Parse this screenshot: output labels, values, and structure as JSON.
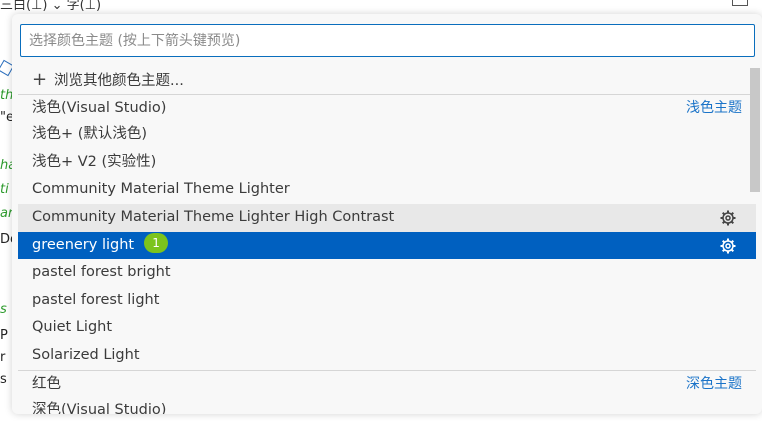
{
  "background": {
    "top_text": "三白(⊥)   ⌄  字(⊥)",
    "fragments": [
      "th",
      "\"e",
      "ha",
      "ti",
      "an",
      "Do",
      "s",
      "P",
      "r",
      "s"
    ]
  },
  "quickpick": {
    "search_placeholder": "选择颜色主题 (按上下箭头键预览)",
    "browse": {
      "icon": "+",
      "label": "浏览其他颜色主题..."
    },
    "items": [
      {
        "label": "浅色(Visual Studio)",
        "group": "浅色主题",
        "separator": true
      },
      {
        "label": "浅色+ (默认浅色)"
      },
      {
        "label": "浅色+ V2 (实验性)"
      },
      {
        "label": "Community Material Theme Lighter"
      },
      {
        "label": "Community Material Theme Lighter High Contrast",
        "gear": true,
        "state": "hover"
      },
      {
        "label": "greenery light",
        "gear": true,
        "state": "selected",
        "badge": "1"
      },
      {
        "label": "pastel forest bright"
      },
      {
        "label": "pastel forest light"
      },
      {
        "label": "Quiet Light"
      },
      {
        "label": "Solarized Light"
      },
      {
        "label": "红色",
        "group": "深色主题",
        "separator": true
      },
      {
        "label": "深色(Visual Studio)"
      }
    ]
  },
  "colors": {
    "selection": "#0060c0",
    "accent_link": "#1a73c8",
    "badge": "#7cc41c",
    "input_border": "#0a6ebd"
  }
}
